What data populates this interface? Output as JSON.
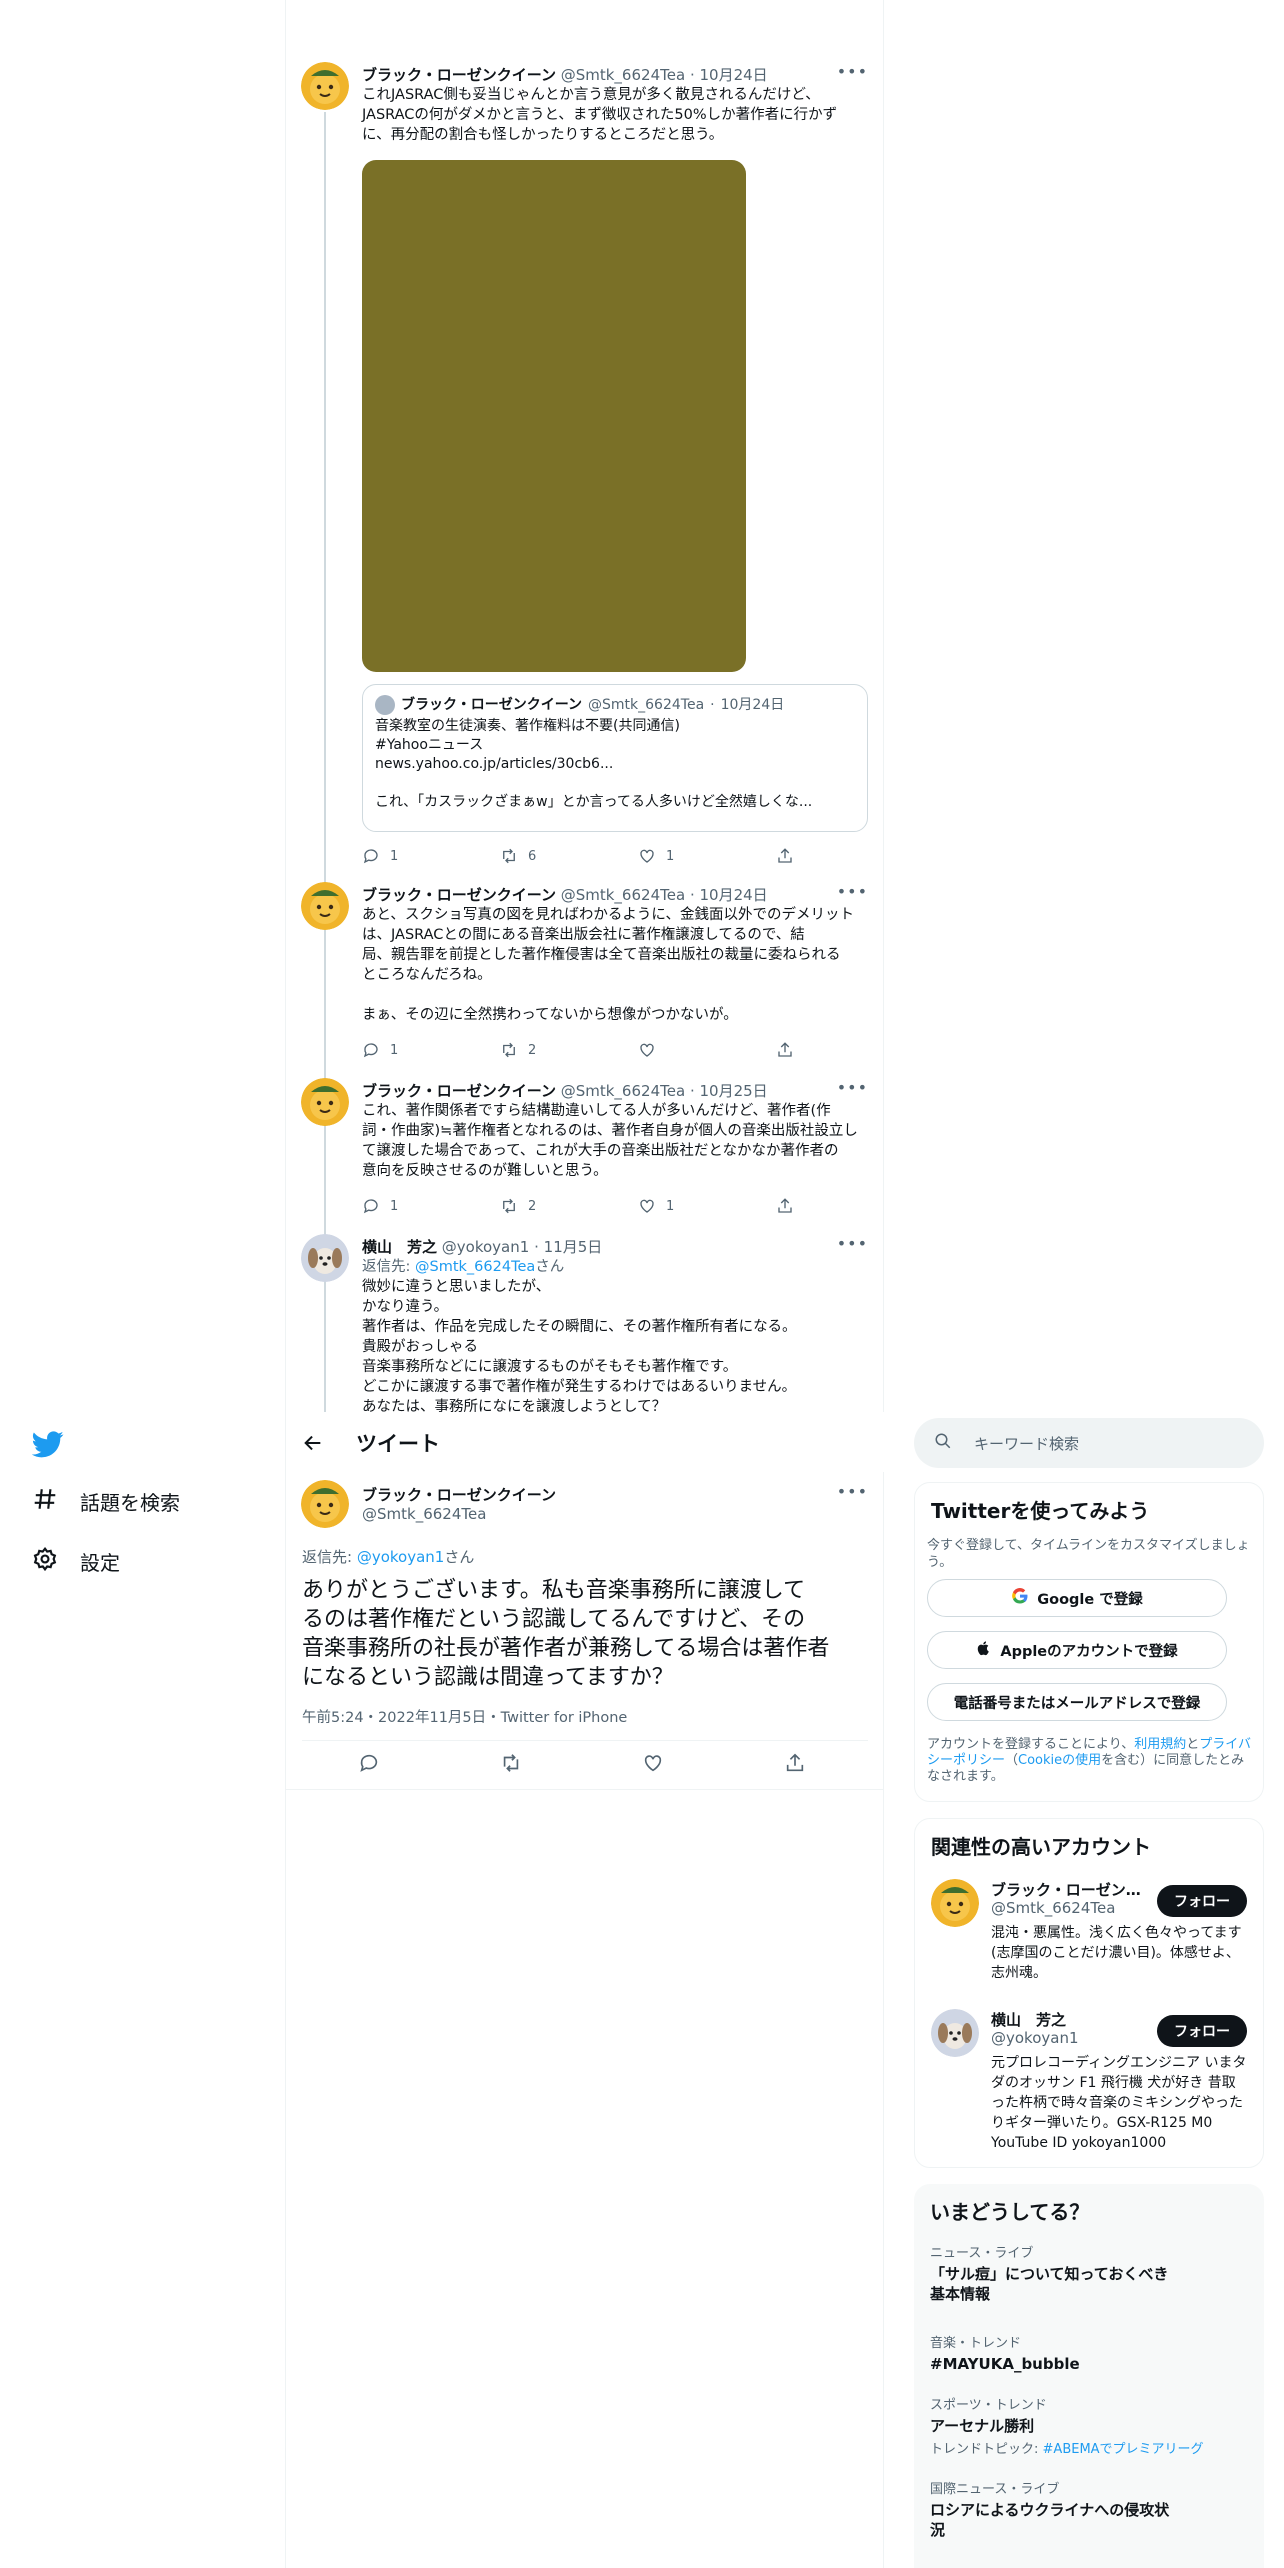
{
  "colors": {
    "accent": "#1d9bf0",
    "text": "#0f1419",
    "muted": "#536471",
    "border": "#eff3f4",
    "media": "#7a7027"
  },
  "nav": {
    "logo_icon": "twitter-bird-icon",
    "explore": {
      "icon": "hashtag-icon",
      "label": "話題を検索"
    },
    "settings": {
      "icon": "gear-icon",
      "label": "設定"
    }
  },
  "header": {
    "back_icon": "arrow-left-icon",
    "title": "ツイート"
  },
  "thread": [
    {
      "name": "ブラック・ローゼンクイーン",
      "handle": "@Smtk_6624Tea",
      "date": "10月24日",
      "lines": [
        "これJASRAC側も妥当じゃんとか言う意見が多く散見されるんだけど、",
        "JASRACの何がダメかと言うと、まず徴収された50%しか著作者に行かず",
        "に、再分配の割合も怪しかったりするところだと思う。"
      ],
      "quote": {
        "name": "ブラック・ローゼンクイーン",
        "handle": "@Smtk_6624Tea",
        "date": "10月24日",
        "lines": [
          "音楽教室の生徒演奏、著作権料は不要(共同通信)",
          "#Yahooニュース",
          "news.yahoo.co.jp/articles/30cb6...",
          "",
          "これ、「カスラックざまぁw」とか言ってる人多いけど全然嬉しくな..."
        ]
      },
      "replies": "1",
      "retweets": "6",
      "likes": "1"
    },
    {
      "name": "ブラック・ローゼンクイーン",
      "handle": "@Smtk_6624Tea",
      "date": "10月24日",
      "lines": [
        "あと、スクショ写真の図を見ればわかるように、金銭面以外でのデメリット",
        "は、JASRACとの間にある音楽出版会社に著作権譲渡してるので、結",
        "局、親告罪を前提とした著作権侵害は全て音楽出版社の裁量に委ねられる",
        "ところなんだろね。",
        "",
        "まぁ、その辺に全然携わってないから想像がつかないが。"
      ],
      "replies": "1",
      "retweets": "2",
      "likes": ""
    },
    {
      "name": "ブラック・ローゼンクイーン",
      "handle": "@Smtk_6624Tea",
      "date": "10月25日",
      "lines": [
        "これ、著作関係者ですら結構勘違いしてる人が多いんだけど、著作者(作",
        "詞・作曲家)≒著作権者となれるのは、著作者自身が個人の音楽出版社設立し",
        "て譲渡した場合であって、これが大手の音楽出版社だとなかなか著作者の",
        "意向を反映させるのが難しいと思う。"
      ],
      "replies": "1",
      "retweets": "2",
      "likes": "1"
    },
    {
      "name": "横山　芳之",
      "handle": "@yokoyan1",
      "date": "11月5日",
      "reply_label": "返信先:",
      "reply_handle": "@Smtk_6624Tea",
      "reply_suffix": "さん",
      "lines": [
        "微妙に違うと思いましたが、",
        "かなり違う。",
        "著作者は、作品を完成したその瞬間に、その著作権所有者になる。",
        "貴殿がおっしゃる",
        "音楽事務所などにに譲渡するものがそもそも著作権です。",
        "どこかに譲渡する事で著作権が発生するわけではあるいりません。",
        "あなたは、事務所になにを譲渡しようとして？"
      ]
    }
  ],
  "main_tweet": {
    "name": "ブラック・ローゼンクイーン",
    "handle": "@Smtk_6624Tea",
    "reply_label": "返信先:",
    "reply_handle": "@yokoyan1",
    "reply_suffix": "さん",
    "lines": [
      "ありがとうございます。私も音楽事務所に譲渡して",
      "るのは著作権だという認識してるんですけど、その",
      "音楽事務所の社長が著作者が兼務してる場合は著作者",
      "になるという認識は間違ってますか？"
    ],
    "meta": "午前5:24・2022年11月5日・Twitter for iPhone"
  },
  "search": {
    "placeholder": "キーワード検索"
  },
  "signup": {
    "title": "Twitterを使ってみよう",
    "subtitle": "今すぐ登録して、タイムラインをカスタマイズしましょう。",
    "google": "Google で登録",
    "apple": "Appleのアカウントで登録",
    "phone": "電話番号またはメールアドレスで登録",
    "legal_pre": "アカウントを登録することにより、",
    "terms": "利用規約",
    "and": "と",
    "privacy": "プライバシーポリシー",
    "cookie_open": "（",
    "cookie": "Cookieの使用",
    "legal_post": "を含む）に同意したとみなされます。"
  },
  "relevant": {
    "title": "関連性の高いアカウント",
    "follow_label": "フォロー",
    "accounts": [
      {
        "name": "ブラック・ローゼンクイーン",
        "handle": "@Smtk_6624Tea",
        "bio": "混沌・悪属性。浅く広く色々やってます(志摩国のことだけ濃い目)。体感せよ、志州魂。"
      },
      {
        "name": "横山　芳之",
        "handle": "@yokoyan1",
        "bio": "元プロレコーディングエンジニア いまタダのオッサン F1 飛行機 犬が好き 昔取った杵柄で時々音楽のミキシングやったりギター弾いたり。GSX-R125 M0 YouTube ID yokoyan1000"
      }
    ]
  },
  "trends": {
    "title": "いまどうしてる？",
    "items": [
      {
        "category": "ニュース・ライブ",
        "title": "「サル痘」について知っておくべき基本情報"
      },
      {
        "category": "音楽・トレンド",
        "title": "#MAYUKA_bubble"
      },
      {
        "category": "スポーツ・トレンド",
        "title": "アーセナル勝利",
        "extra_label": "トレンドトピック:",
        "extra_link": "#ABEMAでプレミアリーグ"
      },
      {
        "category": "国際ニュース・ライブ",
        "title": "ロシアによるウクライナへの侵攻状況"
      }
    ]
  }
}
